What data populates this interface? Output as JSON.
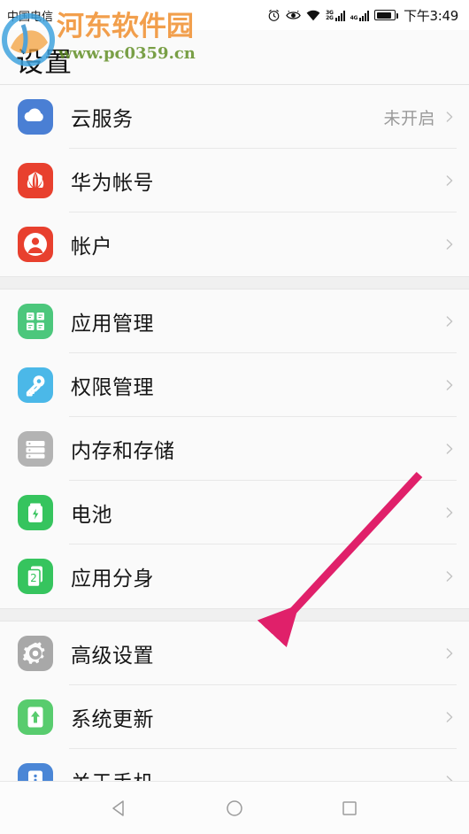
{
  "statusbar": {
    "carrier": "中国电信",
    "time": "下午3:49",
    "icons": [
      "alarm-clock-icon",
      "eye-icon",
      "wifi-icon",
      "signal-3g-2g-icon",
      "signal-4g-icon",
      "battery-icon"
    ],
    "network_labels": {
      "upper": "3G",
      "lower": "2G",
      "second_sim": "4G"
    }
  },
  "header": {
    "title": "设置"
  },
  "watermark": {
    "brand": "河东软件园",
    "url": "www.pc0359.cn"
  },
  "annotation": {
    "color": "#e0206a",
    "points_to": "高级设置"
  },
  "colors": {
    "cloud_blue": "#4a7fd4",
    "huawei_red": "#e8402e",
    "account_red": "#e8402e",
    "apps_green": "#4cc77c",
    "permission_blue": "#4bb8e8",
    "storage_gray": "#b3b3b3",
    "battery_green": "#36c45e",
    "twin_green": "#36c45e",
    "advanced_gray": "#a8a8a8",
    "update_green": "#58cc6e",
    "about_blue": "#4a86d6",
    "accent_pink": "#e0206a"
  },
  "groups": [
    {
      "rows": [
        {
          "label": "云服务",
          "value": "未开启",
          "icon": "cloud-icon"
        },
        {
          "label": "华为帐号",
          "value": "",
          "icon": "huawei-icon"
        },
        {
          "label": "帐户",
          "value": "",
          "icon": "account-icon"
        }
      ]
    },
    {
      "rows": [
        {
          "label": "应用管理",
          "value": "",
          "icon": "apps-grid-icon"
        },
        {
          "label": "权限管理",
          "value": "",
          "icon": "key-icon"
        },
        {
          "label": "内存和存储",
          "value": "",
          "icon": "storage-icon"
        },
        {
          "label": "电池",
          "value": "",
          "icon": "battery-icon"
        },
        {
          "label": "应用分身",
          "value": "",
          "icon": "app-twin-icon"
        }
      ]
    },
    {
      "rows": [
        {
          "label": "高级设置",
          "value": "",
          "icon": "gear-icon"
        },
        {
          "label": "系统更新",
          "value": "",
          "icon": "system-update-icon"
        },
        {
          "label": "关于手机",
          "value": "",
          "icon": "info-phone-icon"
        }
      ]
    }
  ],
  "navbar": {
    "back": "back-triangle-icon",
    "home": "home-circle-icon",
    "recents": "recents-square-icon"
  }
}
